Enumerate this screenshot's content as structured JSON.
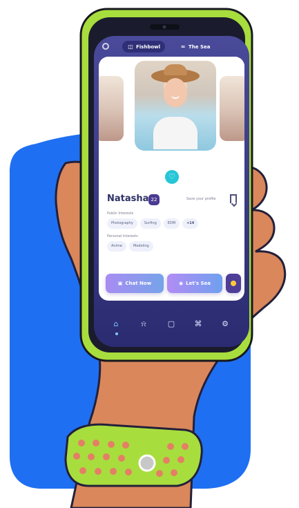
{
  "topbar": {
    "tabs": [
      {
        "label": "Fishbowl"
      },
      {
        "label": "The Sea"
      }
    ]
  },
  "profile": {
    "name": "Natasha",
    "badge_count": "22",
    "save_text": "Save your profile",
    "public_interests_title": "Public Interests",
    "public_interests": [
      "Photography",
      "Surfing",
      "EDM",
      "+14"
    ],
    "personal_interests_title": "Personal Interests",
    "personal_interests": [
      "Anime",
      "Modeling"
    ]
  },
  "actions": {
    "chat_now": "Chat Now",
    "lets_sea": "Let's Sea"
  },
  "icons": {
    "center_badge": "heart-icon"
  },
  "colors": {
    "accent_blue": "#1f6ff2",
    "phone_green": "#a8dd3e",
    "screen_purple": "#3b3b88",
    "chip_bg": "#eef1fb",
    "action_gradient_start": "#a88cf2",
    "action_gradient_end": "#76a3e9"
  }
}
